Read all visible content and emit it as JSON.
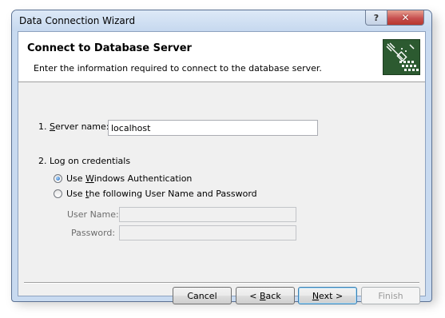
{
  "window": {
    "title": "Data Connection Wizard",
    "help_glyph": "?",
    "close_glyph": "✕"
  },
  "header": {
    "title": "Connect to Database Server",
    "subtitle": "Enter the information required to connect to the database server."
  },
  "server": {
    "label_prefix": "1. ",
    "label_mnemonic": "S",
    "label_rest": "erver name:",
    "value": "localhost"
  },
  "credentials": {
    "section_label": "2. Log on credentials",
    "option_windows": {
      "prefix": "Use ",
      "mnemonic": "W",
      "rest": "indows Authentication",
      "selected": true
    },
    "option_userpass": {
      "prefix": "Use ",
      "mnemonic": "t",
      "rest": "he following User Name and Password",
      "selected": false
    },
    "username_label": "User Name:",
    "username_value": "",
    "password_label": "Password:",
    "password_value": ""
  },
  "buttons": {
    "cancel": "Cancel",
    "back_prefix": "< ",
    "back_mnemonic": "B",
    "back_rest": "ack",
    "next_mnemonic": "N",
    "next_rest": "ext >",
    "finish": "Finish"
  }
}
